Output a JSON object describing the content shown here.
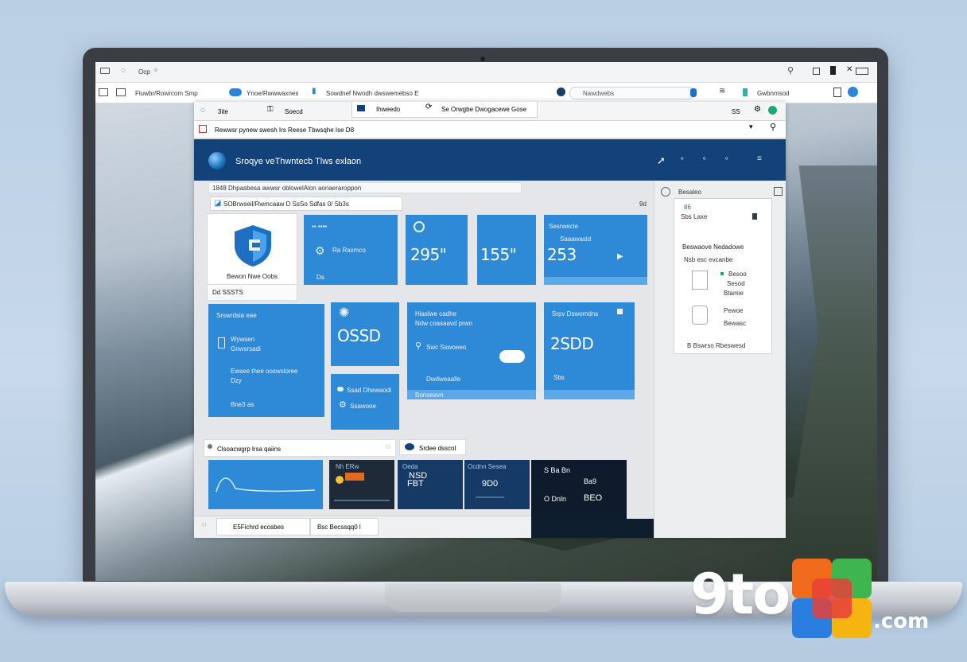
{
  "browser": {
    "title_left": "Ocp",
    "tab_1": "Fluwbr/Rowrcom Smp",
    "tab_2": "Ynoe/Rwwwaxnes",
    "tab_3": "Sowdnef Nwodh dwswemebso E",
    "address": "Nawdwebs",
    "right_label": "Gwbnmsod",
    "sub_tab_1": "Ihweedo",
    "sub_tab_2": "Se Orwgbe Dwogacewe Gose"
  },
  "app": {
    "tab_1": "3ite",
    "tab_2": "Soecd",
    "right_badge": "SS",
    "path": "Rewwsr pynew swesh Irs Reese Tbwsqhe Ise D8",
    "header_title": "Sroqye veThwntecb Tlws exlaon",
    "search_strip": "1848 Dhpasbesa awwsr oblowelAlon aonaeraroppon",
    "breadcrumb": "SOBrwseil/Rwmcaaw D SsSo Sdfas 0/ Sb3s",
    "feature_card_label": "Bewon Nwe Oobs",
    "feature_card_footer": "Dd SSSTS",
    "page_marker": "9d"
  },
  "tiles": {
    "t1_label": "Ra Raxmco",
    "t1_sub": "Ds",
    "t2_value": "295\"",
    "t3_value": "155\"",
    "t4_label": "Sesrwecle",
    "t4_label2": "Saaawasld",
    "t4_value": "253",
    "t5_label": "Srswrdsia eae",
    "t5_l2": "Wywsen",
    "t5_l3": "Gnwsrsadi",
    "t5_l4": "Ewsee thee ooswsloree",
    "t5_l5": "Dzy",
    "t5_l6": "Bne3 as",
    "t6_value": "OSSD",
    "t7_label": "Ssad Dhewaodl",
    "t7_l2": "Ssawooe",
    "t8_label": "Hiaslwe cadhe",
    "t8_l2": "Ndw coasaavd prwn",
    "t8_l3": "Swc Sswoeeo",
    "t8_l4": "Dwdweaalle",
    "t8_l5": "Bonseavn",
    "t9_label": "Srpv Dswomdns",
    "t9_value": "2SDD",
    "t9_sub": "Sbs"
  },
  "bottom": {
    "filter_label": "Clsoacwgrp lrsa qaiins",
    "filter_pill": "Srdee dsscol",
    "card_1_label": "Nh ERw",
    "card_2_label": "Oeda",
    "card_2_val1": "NSD",
    "card_2_val2": "FBT",
    "card_3_label": "Ocdnn Sesea",
    "card_3_val": "9D0",
    "card_4_rows": [
      "S Ba Bn",
      "Ba9",
      "O Dnln",
      "BEO"
    ],
    "footer_left": "E5Fichrd ecosbes",
    "footer_right": "Bsc Becssqq0 l"
  },
  "right_panel": {
    "title": "Besaleo",
    "sub": "86",
    "sub2": "Sbs Laxe",
    "section": "Beswaove Nedadowe",
    "section2": "Nsb esc evcanbe",
    "row_1": "Besoo",
    "row_2": "Sesod",
    "row_3": "Btamie",
    "row_4": "Pewoe",
    "row_5": "Bewasc",
    "footer": "B Bswrso Rbeswesd"
  },
  "branding": {
    "logo_text": "9to5",
    "logo_suffix": ".com",
    "colors": {
      "orange": "#f26a1b",
      "red": "#e83f3a",
      "green": "#3fb64d",
      "blue": "#2a7ee0",
      "yellow": "#f5b40f"
    }
  }
}
